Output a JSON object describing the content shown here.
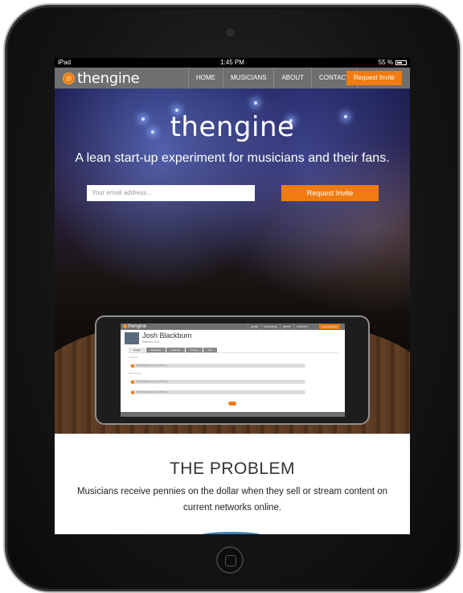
{
  "statusbar": {
    "device": "iPad",
    "time": "1:45 PM",
    "battery": "55 %",
    "battery_level": 0.55
  },
  "nav": {
    "brand": "thengine",
    "links": [
      "HOME",
      "MUSICIANS",
      "ABOUT",
      "CONTACT"
    ],
    "cta": "Request Invite"
  },
  "hero": {
    "title": "thengine",
    "subtitle": "A lean start-up experiment for musicians and their fans.",
    "email_placeholder": "Your email address...",
    "cta": "Request Invite"
  },
  "mockup": {
    "brand": "thengine",
    "nav_links": [
      "HOME",
      "MUSICIANS",
      "ABOUT",
      "CONTACT"
    ],
    "nav_cta": "Request Invite",
    "artist": "Josh Blackburn",
    "location": "Denver, CO",
    "tabs": [
      "Songs",
      "Bookings",
      "Channel",
      "Photos",
      "Bio"
    ],
    "section_now": "Featured",
    "section_more": "More Songs",
    "tracks": [
      "Josh Blackburn (Song Title 1)",
      "Josh Blackburn (Song Title 2)",
      "Josh Blackburn (Song Title 3)"
    ]
  },
  "problem": {
    "title": "THE PROBLEM",
    "body": "Musicians receive pennies on the dollar when they sell or stream content on current networks online."
  },
  "colors": {
    "accent": "#f07b10",
    "nav_bg": "#6f6f6f"
  }
}
